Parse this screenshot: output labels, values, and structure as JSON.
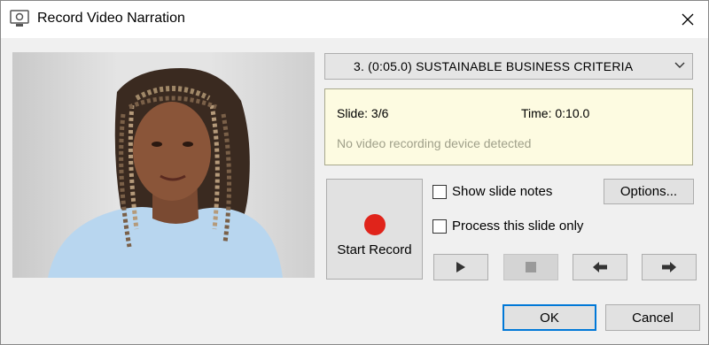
{
  "window": {
    "title": "Record Video Narration",
    "close_icon": "close-icon",
    "app_icon": "presentation-screen-icon"
  },
  "slide_selector": {
    "selected": "3. (0:05.0) SUSTAINABLE BUSINESS CRITERIA",
    "icon": "chevron-down-icon"
  },
  "info_panel": {
    "slide": "Slide: 3/6",
    "time": "Time: 0:10.0",
    "message": "No video recording device detected"
  },
  "record_button": {
    "label": "Start Record",
    "icon": "record-dot-icon",
    "icon_color": "#e0241b"
  },
  "show_notes": {
    "label": "Show slide notes",
    "checked": false
  },
  "process_only": {
    "label": "Process this slide only",
    "checked": false
  },
  "options_button": {
    "label": "Options..."
  },
  "playback": {
    "play_icon": "play-icon",
    "stop_icon": "stop-icon",
    "prev_icon": "arrow-left-icon",
    "next_icon": "arrow-right-icon"
  },
  "footer": {
    "ok_label": "OK",
    "cancel_label": "Cancel"
  },
  "colors": {
    "accent": "#0078d7",
    "info_bg": "#fdfbe1",
    "record": "#e0241b"
  }
}
